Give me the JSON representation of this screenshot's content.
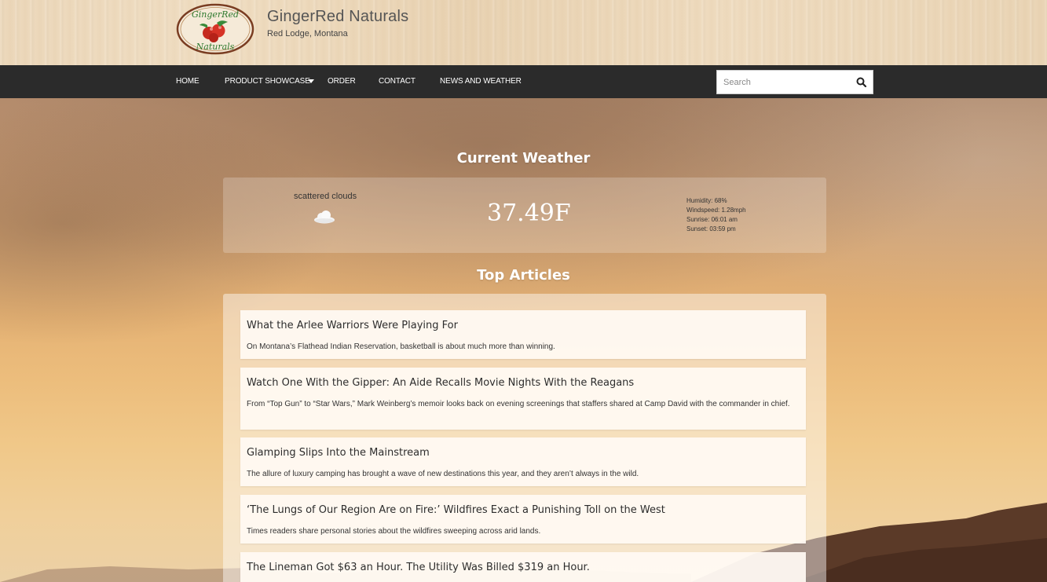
{
  "header": {
    "brand_name": "GingerRed Naturals",
    "location": "Red Lodge, Montana",
    "logo_text_top": "GingerRed",
    "logo_text_bottom": "Naturals"
  },
  "nav": {
    "items": [
      {
        "label": "HOME"
      },
      {
        "label": "PRODUCT SHOWCASE",
        "has_dropdown": true
      },
      {
        "label": "ORDER"
      },
      {
        "label": "CONTACT"
      },
      {
        "label": "NEWS AND WEATHER"
      }
    ],
    "search_placeholder": "Search",
    "search_icon": "search-icon"
  },
  "weather": {
    "title": "Current Weather",
    "description": "scattered clouds",
    "icon": "cloud-icon",
    "temperature": "37.49F",
    "humidity": "Humidity: 68%",
    "windspeed": "Windspeed: 1.28mph",
    "sunrise": "Sunrise: 06:01 am",
    "sunset": "Sunset: 03:59 pm"
  },
  "articles": {
    "title": "Top Articles",
    "items": [
      {
        "title": "What the Arlee Warriors Were Playing For",
        "abstract": "On Montana’s Flathead Indian Reservation, basketball is about much more than winning."
      },
      {
        "title": "Watch One With the Gipper: An Aide Recalls Movie Nights With the Reagans",
        "abstract": "From “Top Gun” to “Star Wars,” Mark Weinberg’s memoir looks back on evening screenings that staffers shared at Camp David with the commander in chief."
      },
      {
        "title": "Glamping Slips Into the Mainstream",
        "abstract": "The allure of luxury camping has brought a wave of new destinations this year, and they aren’t always in the wild."
      },
      {
        "title": "‘The Lungs of Our Region Are on Fire:’ Wildfires Exact a Punishing Toll on the West",
        "abstract": "Times readers share personal stories about the wildfires sweeping across arid lands."
      },
      {
        "title": "The Lineman Got $63 an Hour. The Utility Was Billed $319 an Hour.",
        "abstract": ""
      }
    ]
  },
  "colors": {
    "nav_bg": "#2b2b2b",
    "logo_green": "#3a8a3a",
    "logo_red": "#c62a1f"
  }
}
